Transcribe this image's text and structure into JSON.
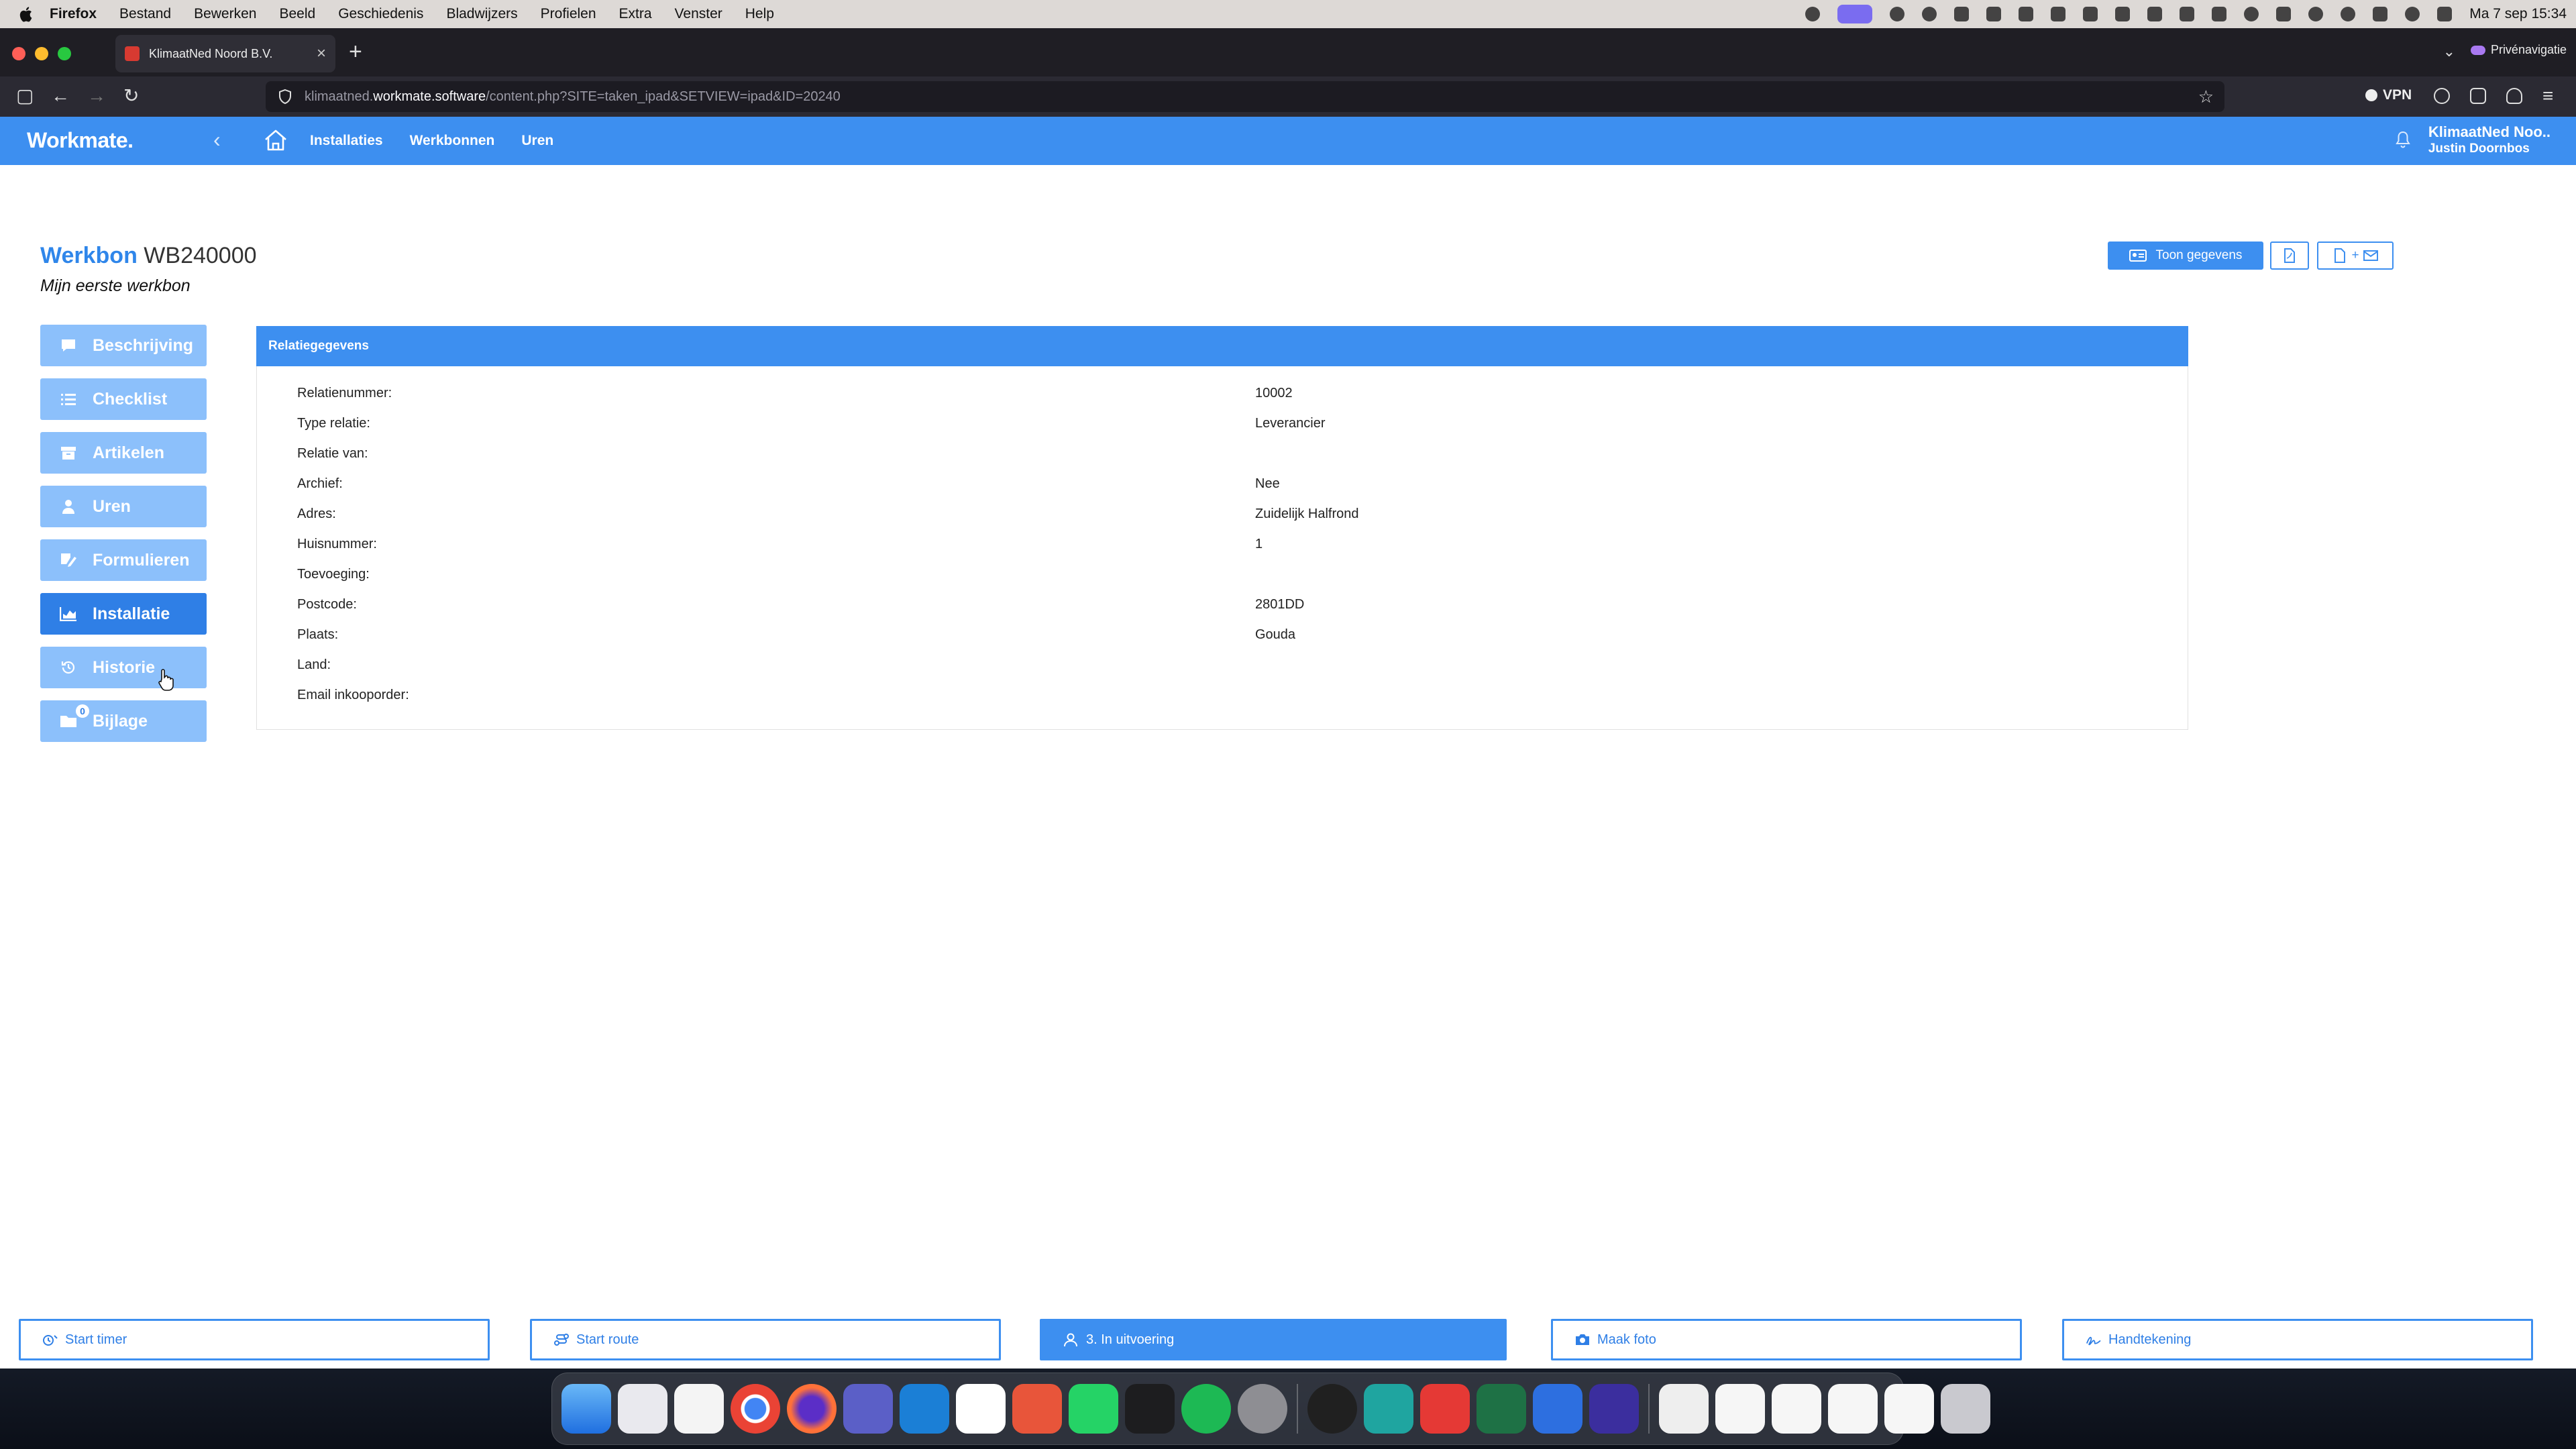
{
  "menubar": {
    "app": "Firefox",
    "items": [
      "Bestand",
      "Bewerken",
      "Beeld",
      "Geschiedenis",
      "Bladwijzers",
      "Profielen",
      "Extra",
      "Venster",
      "Help"
    ],
    "clock": "Ma 7 sep  15:34"
  },
  "browser": {
    "tab_title": "KlimaatNed Noord B.V.",
    "url_prefix": "klimaatned.",
    "url_domain": "workmate.software",
    "url_path": "/content.php?SITE=taken_ipad&SETVIEW=ipad&ID=20240",
    "vpn_label": "VPN",
    "private_label": "Privénavigatie"
  },
  "app": {
    "logo": "Workmate.",
    "nav": [
      "Installaties",
      "Werkbonnen",
      "Uren"
    ],
    "company": "KlimaatNed Noo..",
    "user": "Justin Doornbos",
    "brand_color": "#3d8ff0"
  },
  "header": {
    "title_label": "Werkbon",
    "title_number": "WB240000",
    "subtitle": "Mijn eerste werkbon",
    "toon_gegevens": "Toon gegevens",
    "pdf_mail": "+"
  },
  "sidebar": {
    "items": [
      {
        "label": "Beschrijving",
        "icon": "comment-icon"
      },
      {
        "label": "Checklist",
        "icon": "list-icon"
      },
      {
        "label": "Artikelen",
        "icon": "box-icon"
      },
      {
        "label": "Uren",
        "icon": "user-icon"
      },
      {
        "label": "Formulieren",
        "icon": "form-icon"
      },
      {
        "label": "Installatie",
        "icon": "chart-icon",
        "active": true
      },
      {
        "label": "Historie",
        "icon": "history-icon"
      },
      {
        "label": "Bijlage",
        "icon": "folder-icon",
        "badge": "0"
      }
    ]
  },
  "panel": {
    "title": "Relatiegegevens",
    "rows": [
      {
        "label": "Relatienummer:",
        "value": "10002"
      },
      {
        "label": "Type relatie:",
        "value": "Leverancier"
      },
      {
        "label": "Relatie van:",
        "value": ""
      },
      {
        "label": "Archief:",
        "value": "Nee"
      },
      {
        "label": "Adres:",
        "value": "Zuidelijk Halfrond"
      },
      {
        "label": "Huisnummer:",
        "value": "1"
      },
      {
        "label": "Toevoeging:",
        "value": ""
      },
      {
        "label": "Postcode:",
        "value": "2801DD"
      },
      {
        "label": "Plaats:",
        "value": "Gouda"
      },
      {
        "label": "Land:",
        "value": ""
      },
      {
        "label": "Email inkooporder:",
        "value": ""
      }
    ]
  },
  "footer": {
    "start_timer": "Start timer",
    "start_route": "Start route",
    "status": "3. In uitvoering",
    "maak_foto": "Maak foto",
    "handtekening": "Handtekening"
  }
}
